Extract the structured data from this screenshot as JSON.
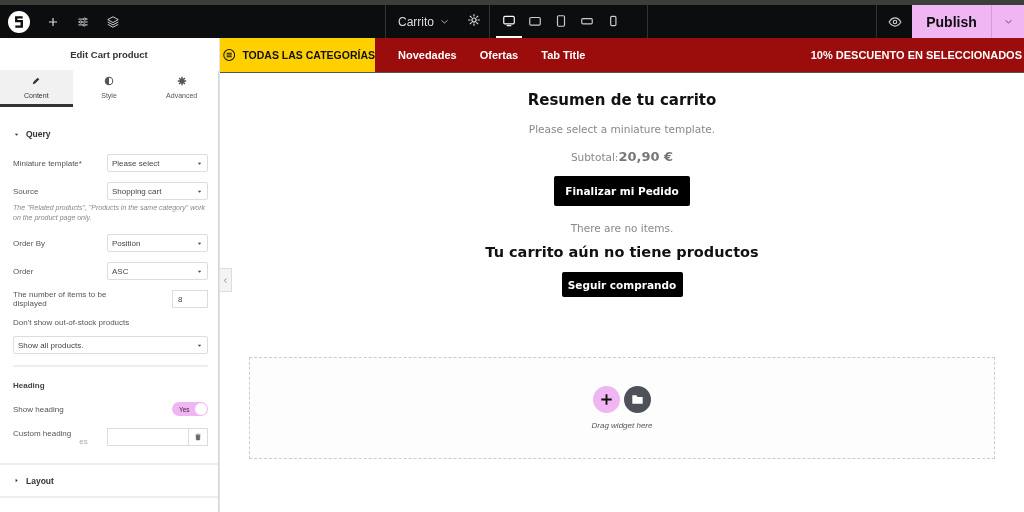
{
  "toolbar": {
    "page_name": "Carrito",
    "devices": [
      {
        "kind": "desktop",
        "selected": true
      },
      {
        "kind": "tablet-landscape",
        "selected": false
      },
      {
        "kind": "tablet",
        "selected": false
      },
      {
        "kind": "mobile-landscape",
        "selected": false
      },
      {
        "kind": "mobile",
        "selected": false
      }
    ],
    "publish": "Publish"
  },
  "panel": {
    "title": "Edit Cart product",
    "tabs": [
      {
        "kind": "content",
        "label": "Content",
        "selected": true
      },
      {
        "kind": "style",
        "label": "Style",
        "selected": false
      },
      {
        "kind": "advanced",
        "label": "Advanced",
        "selected": false
      }
    ],
    "section": {
      "title": "Query",
      "expanded": true,
      "controls": [
        {
          "kind": "select",
          "label": "Miniature template*",
          "value": "Please select"
        },
        {
          "kind": "select",
          "label": "Source",
          "value": "Shopping cart"
        },
        {
          "kind": "note",
          "text": "The \"Related products\", \"Products in the same category\" work on the product page only."
        },
        {
          "kind": "select",
          "label": "Order By",
          "value": "Position"
        },
        {
          "kind": "select",
          "label": "Order",
          "value": "ASC"
        },
        {
          "kind": "number",
          "label": "The number of items to be displayed",
          "value": "8"
        },
        {
          "kind": "label",
          "label": "Don't show out-of-stock products"
        },
        {
          "kind": "wide-select",
          "value": "Show all products."
        },
        {
          "kind": "heading",
          "label": "Heading"
        },
        {
          "kind": "switch",
          "label": "Show heading",
          "on": true,
          "text": "Yes"
        },
        {
          "kind": "text",
          "label": "Custom heading",
          "lang": "es"
        }
      ]
    },
    "collapsed": [
      {
        "title": "Layout",
        "expanded": false
      }
    ]
  },
  "nav": {
    "menu": "TODAS LAS CATEGORÍAS",
    "links": [
      "Novedades",
      "Ofertas",
      "Tab Title"
    ],
    "promo": "10% DESCUENTO EN SELECCIONADOS"
  },
  "cart": {
    "title": "Resumen de tu carrito",
    "notice": "Please select a miniature template.",
    "subtotal_label": "Subtotal:",
    "subtotal_value": "20,90 €",
    "checkout": "Finalizar mi Pedido",
    "empty_text": "There are no items.",
    "empty_title": "Tu carrito aún no tiene productos",
    "continue": "Seguir comprando"
  },
  "dropzone": {
    "hint": "Drag widget here"
  }
}
